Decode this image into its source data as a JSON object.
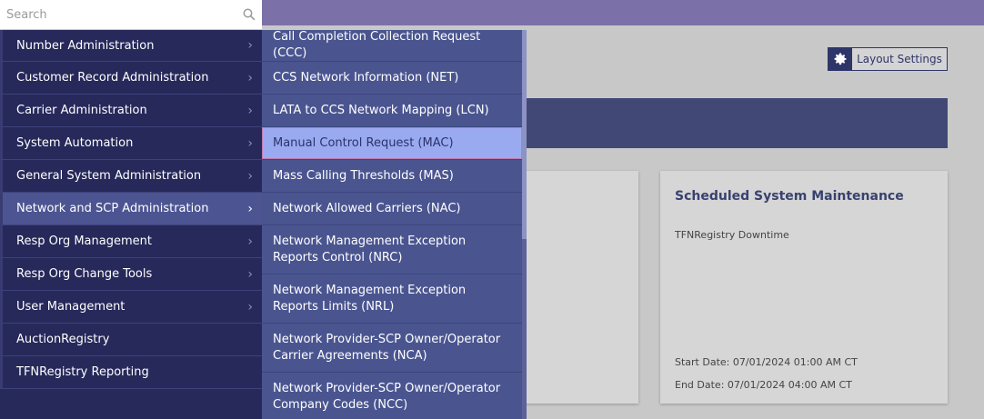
{
  "search": {
    "placeholder": "Search"
  },
  "layout_settings": {
    "label": "Layout Settings"
  },
  "maintenance_card": {
    "title": "Scheduled System Maintenance",
    "subtitle": "TFNRegistry Downtime",
    "start": "Start Date: 07/01/2024 01:00 AM CT",
    "end": "End Date:  07/01/2024 04:00 AM CT"
  },
  "menu": [
    {
      "label": "Number Administration",
      "has_sub": true
    },
    {
      "label": "Customer Record Administration",
      "has_sub": true
    },
    {
      "label": "Carrier Administration",
      "has_sub": true
    },
    {
      "label": "System Automation",
      "has_sub": true
    },
    {
      "label": "General System Administration",
      "has_sub": true
    },
    {
      "label": "Network and SCP Administration",
      "has_sub": true
    },
    {
      "label": "Resp Org Management",
      "has_sub": true
    },
    {
      "label": "Resp Org Change Tools",
      "has_sub": true
    },
    {
      "label": "User Management",
      "has_sub": true
    },
    {
      "label": "AuctionRegistry",
      "has_sub": false
    },
    {
      "label": "TFNRegistry Reporting",
      "has_sub": false
    }
  ],
  "submenu": [
    {
      "label": "Call Completion Collection Request (CCC)"
    },
    {
      "label": "CCS Network Information (NET)"
    },
    {
      "label": "LATA to CCS Network Mapping (LCN)"
    },
    {
      "label": "Manual Control Request (MAC)"
    },
    {
      "label": "Mass Calling Thresholds (MAS)"
    },
    {
      "label": "Network Allowed Carriers (NAC)"
    },
    {
      "label": "Network Management Exception Reports Control (NRC)"
    },
    {
      "label": "Network Management Exception Reports Limits (NRL)"
    },
    {
      "label": "Network Provider-SCP Owner/Operator Carrier Agreements (NCA)"
    },
    {
      "label": "Network Provider-SCP Owner/Operator Company Codes (NCC)"
    }
  ],
  "colors": {
    "accent": "#26295a",
    "submenu": "#4a5590",
    "highlight": "#9aaaf0",
    "top_strip": "#7b71a8"
  },
  "icons": {
    "search": "search-icon",
    "chevron": "chevron-right-icon",
    "gear": "gear-icon"
  }
}
